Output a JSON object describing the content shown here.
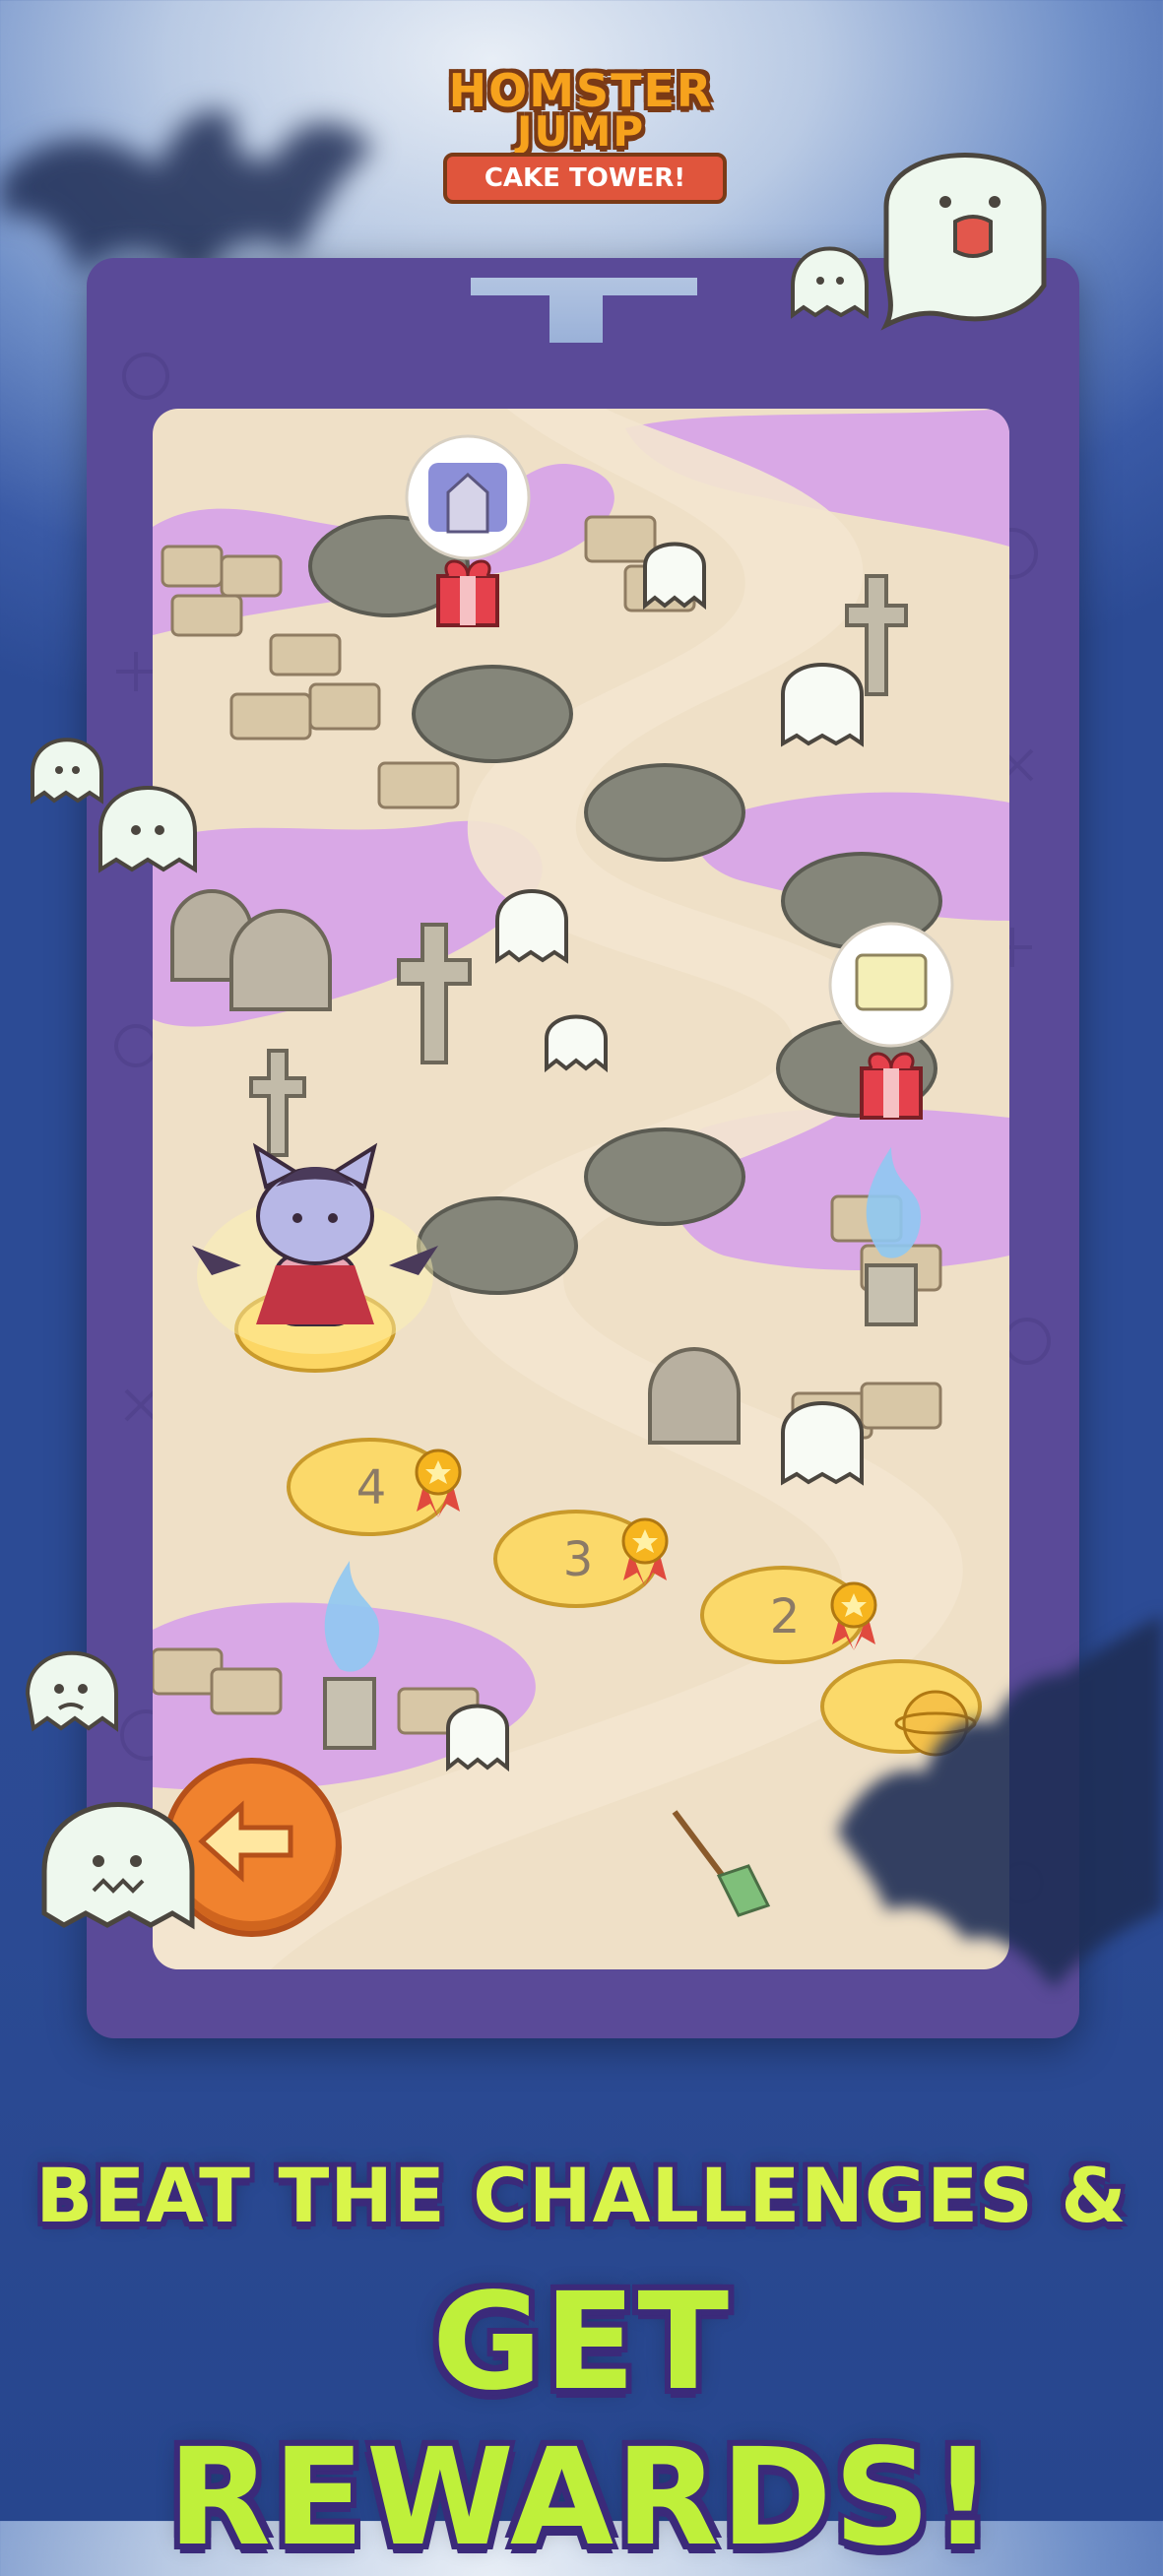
{
  "logo": {
    "line1": "HOMSTER",
    "line2": "JUMP",
    "ribbon": "CAKE TOWER!"
  },
  "tagline": {
    "line1": "BEAT THE CHALLENGES &",
    "line2": "GET REWARDS!"
  },
  "levels": [
    {
      "number": "4",
      "medal": true
    },
    {
      "number": "3",
      "medal": true
    },
    {
      "number": "2",
      "medal": true
    }
  ],
  "colors": {
    "frame": "#5a4a98",
    "path": "#efe0c7",
    "slime": "#d9a8e6",
    "stone": "#8a8a7e",
    "level_pad": "#fbd96a",
    "tagline_fill": "#d9f54a",
    "tagline_outline": "#3b2a7a"
  },
  "icons": {
    "back_button": "arrow-left-icon",
    "gift": "gift-box-icon",
    "medal": "star-medal-icon"
  }
}
